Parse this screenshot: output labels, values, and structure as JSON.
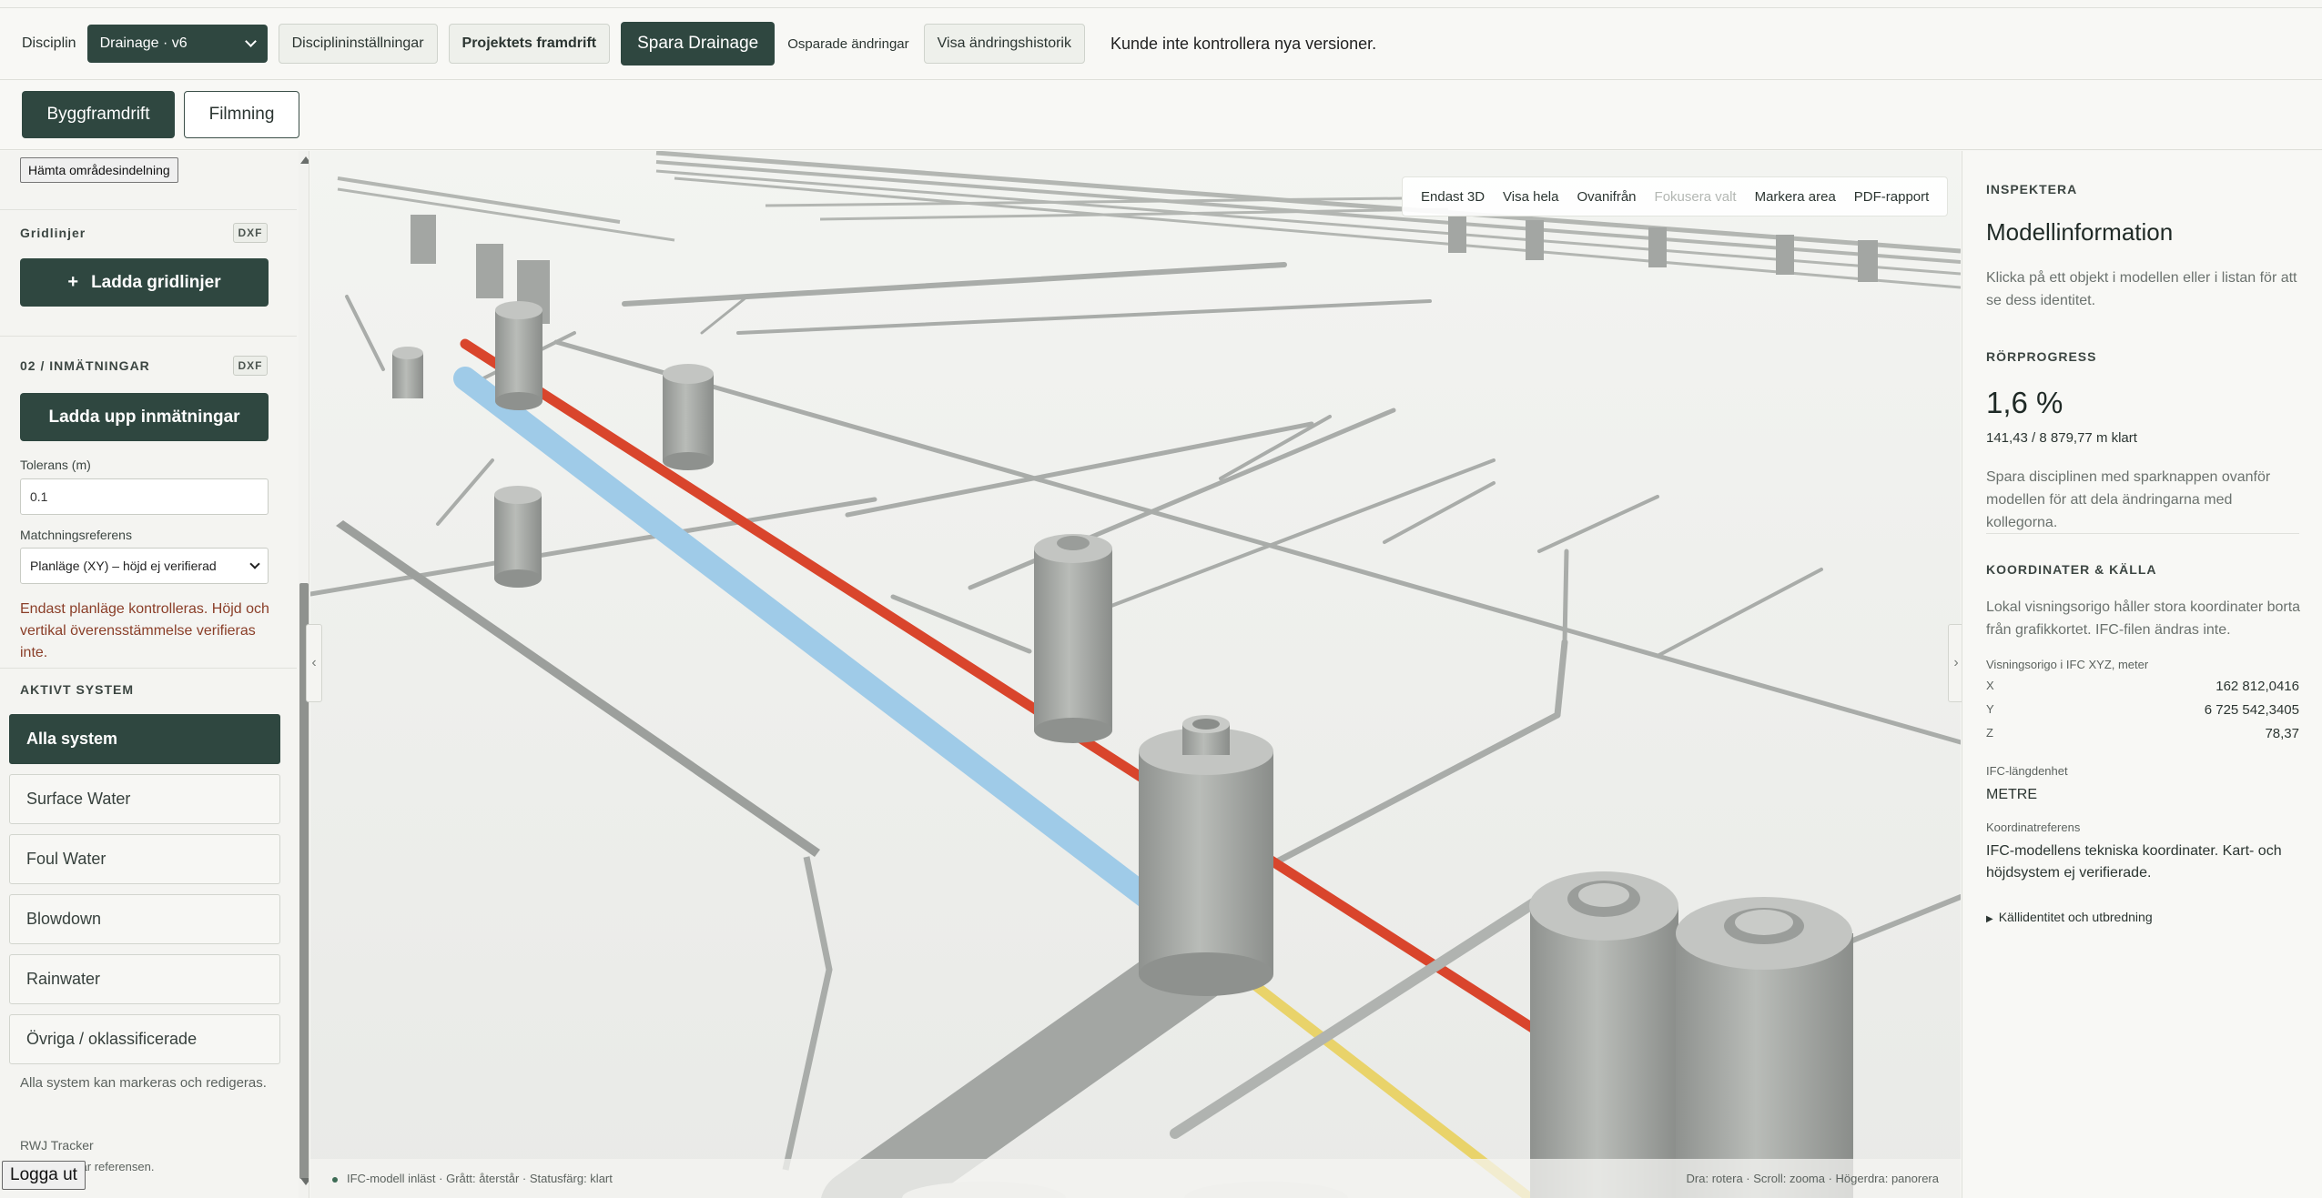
{
  "topbar": {
    "discipline_label": "Disciplin",
    "discipline_value": "Drainage · v6",
    "settings_button": "Disciplininställningar",
    "progress_button": "Projektets framdrift",
    "save_button": "Spara Drainage",
    "unsaved_status": "Osparade ändringar",
    "history_button": "Visa ändringshistorik",
    "message": "Kunde inte kontrollera nya versioner."
  },
  "tabs": {
    "active": "Byggframdrift",
    "other": "Filmning"
  },
  "sidebar": {
    "fetch_areas_button": "Hämta områdesindelning",
    "gridlines": {
      "heading": "Gridlinjer",
      "badge": "DXF",
      "button": "Ladda gridlinjer"
    },
    "measurements": {
      "heading": "02 / INMÄTNINGAR",
      "badge": "DXF",
      "button": "Ladda upp inmätningar",
      "tolerance_label": "Tolerans (m)",
      "tolerance_value": "0.1",
      "matching_label": "Matchningsreferens",
      "matching_value": "Planläge (XY) – höjd ej verifierad",
      "warning": "Endast planläge kontrolleras. Höjd och vertikal överensstämmelse verifieras inte."
    },
    "active_system": {
      "heading": "AKTIVT SYSTEM",
      "items": [
        "Alla system",
        "Surface Water",
        "Foul Water",
        "Blowdown",
        "Rainwater",
        "Övriga / oklassificerade"
      ],
      "note": "Alla system kan markeras och redigeras."
    },
    "footer_title": "RWJ Tracker",
    "footer_text": "gnen är referensen.",
    "logout_button": "Logga ut"
  },
  "viewport": {
    "toolbar": [
      "Endast 3D",
      "Visa hela",
      "Ovanifrån",
      "Fokusera valt",
      "Markera area",
      "PDF-rapport"
    ],
    "status_left": "IFC-modell inläst · Grått: återstår · Statusfärg: klart",
    "status_right": "Dra: rotera · Scroll: zooma · Högerdra: panorera"
  },
  "inspector": {
    "section": "INSPEKTERA",
    "title": "Modellinformation",
    "hint": "Klicka på ett objekt i modellen eller i listan för att se dess identitet.",
    "progress_heading": "RÖRPROGRESS",
    "progress_value": "1,6 %",
    "progress_detail": "141,43 / 8 879,77 m klart",
    "progress_note": "Spara disciplinen med sparknappen ovanför modellen för att dela ändringarna med kollegorna.",
    "coords_heading": "KOORDINATER & KÄLLA",
    "coords_text": "Lokal visningsorigo håller stora koordinater borta från grafikkortet. IFC-filen ändras inte.",
    "origin_label": "Visningsorigo i IFC XYZ, meter",
    "x_label": "X",
    "x_value": "162 812,0416",
    "y_label": "Y",
    "y_value": "6 725 542,3405",
    "z_label": "Z",
    "z_value": "78,37",
    "unit_label": "IFC-längdenhet",
    "unit_value": "METRE",
    "ref_label": "Koordinatreferens",
    "ref_value": "IFC-modellens tekniska koordinater. Kart- och höjdsystem ej verifierade.",
    "details_label": "Källidentitet och utbredning"
  },
  "colors": {
    "brand_dark": "#2f4740",
    "pipe_blue": "#9fcbe8",
    "pipe_yellow": "#e9d36a",
    "pipe_red": "#d9452c",
    "pipe_grey": "#a9aca9",
    "warning_text": "#8a3e28"
  }
}
